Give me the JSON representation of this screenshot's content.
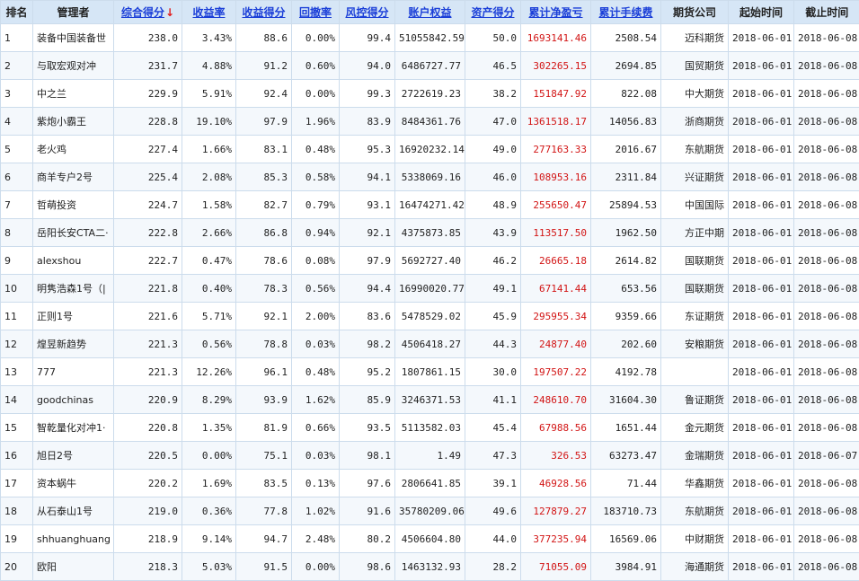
{
  "columns": {
    "rank": "排名",
    "manager": "管理者",
    "total_score": "综合得分",
    "sort_arrow": "↓",
    "return_rate": "收益率",
    "return_score": "收益得分",
    "drawdown": "回撤率",
    "risk_score": "风控得分",
    "equity": "账户权益",
    "asset_score": "资产得分",
    "net_profit": "累计净盈亏",
    "fees": "累计手续费",
    "broker": "期货公司",
    "start": "起始时间",
    "end": "截止时间"
  },
  "rows": [
    {
      "rank": "1",
      "manager": "装备中国装备世",
      "total": "238.0",
      "ret": "3.43%",
      "retscore": "88.6",
      "dd": "0.00%",
      "risk": "99.4",
      "equity": "51055842.59",
      "asset": "50.0",
      "profit": "1693141.46",
      "fees": "2508.54",
      "broker": "迈科期货",
      "start": "2018-06-01",
      "end": "2018-06-08"
    },
    {
      "rank": "2",
      "manager": "与取宏观对冲",
      "total": "231.7",
      "ret": "4.88%",
      "retscore": "91.2",
      "dd": "0.60%",
      "risk": "94.0",
      "equity": "6486727.77",
      "asset": "46.5",
      "profit": "302265.15",
      "fees": "2694.85",
      "broker": "国贸期货",
      "start": "2018-06-01",
      "end": "2018-06-08"
    },
    {
      "rank": "3",
      "manager": "中之兰",
      "total": "229.9",
      "ret": "5.91%",
      "retscore": "92.4",
      "dd": "0.00%",
      "risk": "99.3",
      "equity": "2722619.23",
      "asset": "38.2",
      "profit": "151847.92",
      "fees": "822.08",
      "broker": "中大期货",
      "start": "2018-06-01",
      "end": "2018-06-08"
    },
    {
      "rank": "4",
      "manager": "紫炮小霸王",
      "total": "228.8",
      "ret": "19.10%",
      "retscore": "97.9",
      "dd": "1.96%",
      "risk": "83.9",
      "equity": "8484361.76",
      "asset": "47.0",
      "profit": "1361518.17",
      "fees": "14056.83",
      "broker": "浙商期货",
      "start": "2018-06-01",
      "end": "2018-06-08"
    },
    {
      "rank": "5",
      "manager": "老火鸡",
      "total": "227.4",
      "ret": "1.66%",
      "retscore": "83.1",
      "dd": "0.48%",
      "risk": "95.3",
      "equity": "16920232.14",
      "asset": "49.0",
      "profit": "277163.33",
      "fees": "2016.67",
      "broker": "东航期货",
      "start": "2018-06-01",
      "end": "2018-06-08"
    },
    {
      "rank": "6",
      "manager": "商羊专户2号",
      "total": "225.4",
      "ret": "2.08%",
      "retscore": "85.3",
      "dd": "0.58%",
      "risk": "94.1",
      "equity": "5338069.16",
      "asset": "46.0",
      "profit": "108953.16",
      "fees": "2311.84",
      "broker": "兴证期货",
      "start": "2018-06-01",
      "end": "2018-06-08"
    },
    {
      "rank": "7",
      "manager": "哲萌投资",
      "total": "224.7",
      "ret": "1.58%",
      "retscore": "82.7",
      "dd": "0.79%",
      "risk": "93.1",
      "equity": "16474271.42",
      "asset": "48.9",
      "profit": "255650.47",
      "fees": "25894.53",
      "broker": "中国国际",
      "start": "2018-06-01",
      "end": "2018-06-08"
    },
    {
      "rank": "8",
      "manager": "岳阳长安CTA二·",
      "total": "222.8",
      "ret": "2.66%",
      "retscore": "86.8",
      "dd": "0.94%",
      "risk": "92.1",
      "equity": "4375873.85",
      "asset": "43.9",
      "profit": "113517.50",
      "fees": "1962.50",
      "broker": "方正中期",
      "start": "2018-06-01",
      "end": "2018-06-08"
    },
    {
      "rank": "9",
      "manager": "alexshou",
      "total": "222.7",
      "ret": "0.47%",
      "retscore": "78.6",
      "dd": "0.08%",
      "risk": "97.9",
      "equity": "5692727.40",
      "asset": "46.2",
      "profit": "26665.18",
      "fees": "2614.82",
      "broker": "国联期货",
      "start": "2018-06-01",
      "end": "2018-06-08"
    },
    {
      "rank": "10",
      "manager": "明隽浩森1号（|",
      "total": "221.8",
      "ret": "0.40%",
      "retscore": "78.3",
      "dd": "0.56%",
      "risk": "94.4",
      "equity": "16990020.77",
      "asset": "49.1",
      "profit": "67141.44",
      "fees": "653.56",
      "broker": "国联期货",
      "start": "2018-06-01",
      "end": "2018-06-08"
    },
    {
      "rank": "11",
      "manager": "正则1号",
      "total": "221.6",
      "ret": "5.71%",
      "retscore": "92.1",
      "dd": "2.00%",
      "risk": "83.6",
      "equity": "5478529.02",
      "asset": "45.9",
      "profit": "295955.34",
      "fees": "9359.66",
      "broker": "东证期货",
      "start": "2018-06-01",
      "end": "2018-06-08"
    },
    {
      "rank": "12",
      "manager": "煌昱新趋势",
      "total": "221.3",
      "ret": "0.56%",
      "retscore": "78.8",
      "dd": "0.03%",
      "risk": "98.2",
      "equity": "4506418.27",
      "asset": "44.3",
      "profit": "24877.40",
      "fees": "202.60",
      "broker": "安粮期货",
      "start": "2018-06-01",
      "end": "2018-06-08"
    },
    {
      "rank": "13",
      "manager": "777",
      "total": "221.3",
      "ret": "12.26%",
      "retscore": "96.1",
      "dd": "0.48%",
      "risk": "95.2",
      "equity": "1807861.15",
      "asset": "30.0",
      "profit": "197507.22",
      "fees": "4192.78",
      "broker": "",
      "start": "2018-06-01",
      "end": "2018-06-08"
    },
    {
      "rank": "14",
      "manager": "goodchinas",
      "total": "220.9",
      "ret": "8.29%",
      "retscore": "93.9",
      "dd": "1.62%",
      "risk": "85.9",
      "equity": "3246371.53",
      "asset": "41.1",
      "profit": "248610.70",
      "fees": "31604.30",
      "broker": "鲁证期货",
      "start": "2018-06-01",
      "end": "2018-06-08"
    },
    {
      "rank": "15",
      "manager": "智乾量化对冲1·",
      "total": "220.8",
      "ret": "1.35%",
      "retscore": "81.9",
      "dd": "0.66%",
      "risk": "93.5",
      "equity": "5113582.03",
      "asset": "45.4",
      "profit": "67988.56",
      "fees": "1651.44",
      "broker": "金元期货",
      "start": "2018-06-01",
      "end": "2018-06-08"
    },
    {
      "rank": "16",
      "manager": "旭日2号",
      "total": "220.5",
      "ret": "0.00%",
      "retscore": "75.1",
      "dd": "0.03%",
      "risk": "98.1",
      "equity": "1.49",
      "asset": "47.3",
      "profit": "326.53",
      "fees": "63273.47",
      "broker": "金瑞期货",
      "start": "2018-06-01",
      "end": "2018-06-07"
    },
    {
      "rank": "17",
      "manager": "资本蜗牛",
      "total": "220.2",
      "ret": "1.69%",
      "retscore": "83.5",
      "dd": "0.13%",
      "risk": "97.6",
      "equity": "2806641.85",
      "asset": "39.1",
      "profit": "46928.56",
      "fees": "71.44",
      "broker": "华鑫期货",
      "start": "2018-06-01",
      "end": "2018-06-08"
    },
    {
      "rank": "18",
      "manager": "从石泰山1号",
      "total": "219.0",
      "ret": "0.36%",
      "retscore": "77.8",
      "dd": "1.02%",
      "risk": "91.6",
      "equity": "35780209.06",
      "asset": "49.6",
      "profit": "127879.27",
      "fees": "183710.73",
      "broker": "东航期货",
      "start": "2018-06-01",
      "end": "2018-06-08"
    },
    {
      "rank": "19",
      "manager": "shhuanghuang",
      "total": "218.9",
      "ret": "9.14%",
      "retscore": "94.7",
      "dd": "2.48%",
      "risk": "80.2",
      "equity": "4506604.80",
      "asset": "44.0",
      "profit": "377235.94",
      "fees": "16569.06",
      "broker": "中财期货",
      "start": "2018-06-01",
      "end": "2018-06-08"
    },
    {
      "rank": "20",
      "manager": "欧阳",
      "total": "218.3",
      "ret": "5.03%",
      "retscore": "91.5",
      "dd": "0.00%",
      "risk": "98.6",
      "equity": "1463132.93",
      "asset": "28.2",
      "profit": "71055.09",
      "fees": "3984.91",
      "broker": "海通期货",
      "start": "2018-06-01",
      "end": "2018-06-08"
    }
  ]
}
